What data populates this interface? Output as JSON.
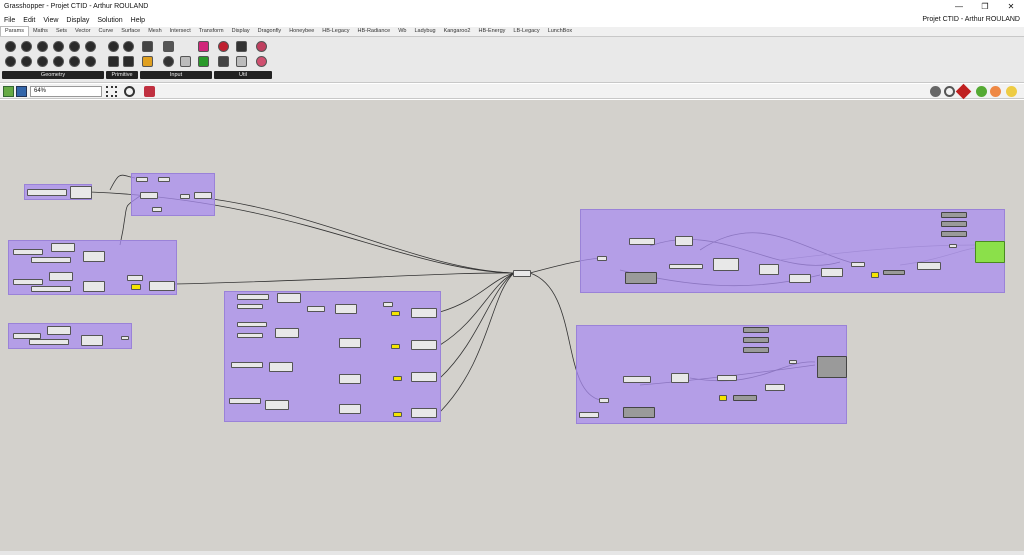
{
  "window": {
    "title": "Grasshopper - Projet CTID - Arthur ROULAND",
    "project_label": "Projet CTID - Arthur ROULAND"
  },
  "menu": [
    "File",
    "Edit",
    "View",
    "Display",
    "Solution",
    "Help"
  ],
  "tabs": [
    "Params",
    "Maths",
    "Sets",
    "Vector",
    "Curve",
    "Surface",
    "Mesh",
    "Intersect",
    "Transform",
    "Display",
    "Dragonfly",
    "Honeybee",
    "HB-Legacy",
    "HB-Radiance",
    "Wb",
    "Ladybug",
    "Kangaroo2",
    "HB-Energy",
    "LB-Legacy",
    "LunchBox"
  ],
  "active_tab": "Params",
  "ribbon_groups": [
    "Geometry",
    "Primitive",
    "Input",
    "Util"
  ],
  "zoom": "64%",
  "colors": {
    "group_fill": "#b39cf0",
    "canvas": "#d3d1cc",
    "panel_yellow": "#f5e400",
    "preview_green": "#8be04a"
  }
}
